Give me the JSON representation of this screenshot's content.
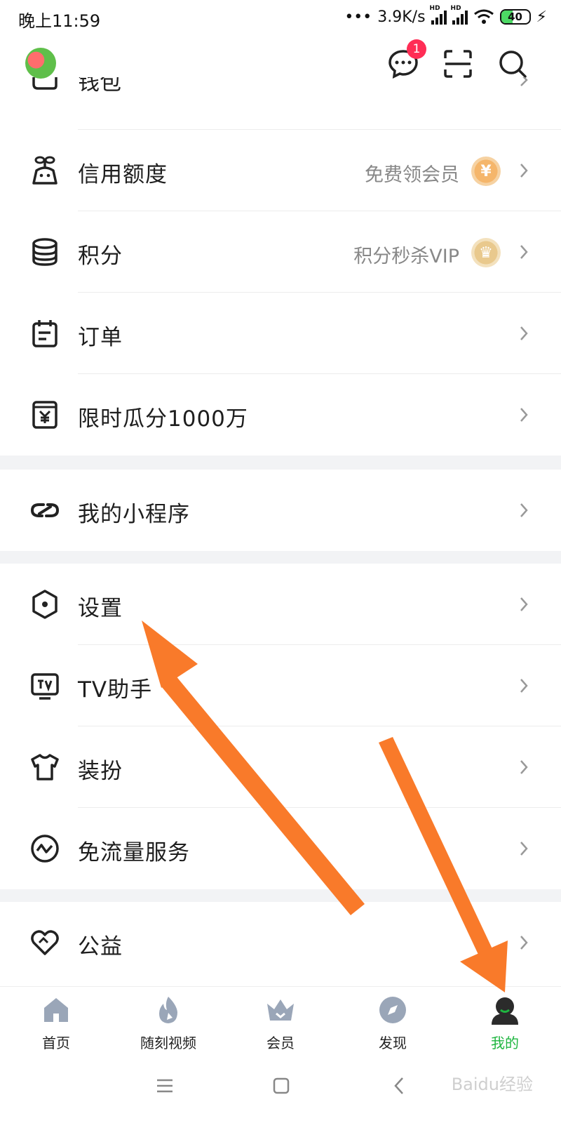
{
  "status_bar": {
    "time": "晚上11:59",
    "network_speed": "3.9K/s",
    "signal_label": "HD",
    "battery_level": "40",
    "battery_color": "#4cd964"
  },
  "top_bar": {
    "message_badge": "1",
    "icons": [
      "message-icon",
      "scan-icon",
      "search-icon"
    ]
  },
  "menu": {
    "partial_item": "钱包",
    "items": [
      {
        "label": "信用额度",
        "promo": "免费领会员",
        "promo_icon": "¥"
      },
      {
        "label": "积分",
        "promo": "积分秒杀VIP",
        "promo_icon": "♛"
      },
      {
        "label": "订单"
      },
      {
        "label": "限时瓜分1000万"
      },
      {
        "label": "我的小程序"
      },
      {
        "label": "设置"
      },
      {
        "label": "TV助手"
      },
      {
        "label": "装扮"
      },
      {
        "label": "免流量服务"
      },
      {
        "label": "公益"
      }
    ]
  },
  "bottom_nav": {
    "items": [
      {
        "label": "首页",
        "icon": "home-icon"
      },
      {
        "label": "随刻视频",
        "icon": "flame-icon"
      },
      {
        "label": "会员",
        "icon": "crown-icon"
      },
      {
        "label": "发现",
        "icon": "compass-icon"
      },
      {
        "label": "我的",
        "icon": "profile-icon"
      }
    ],
    "active_color": "#1fb640"
  },
  "watermark": "Baidu经验",
  "accent_arrow_color": "#f97a2a"
}
